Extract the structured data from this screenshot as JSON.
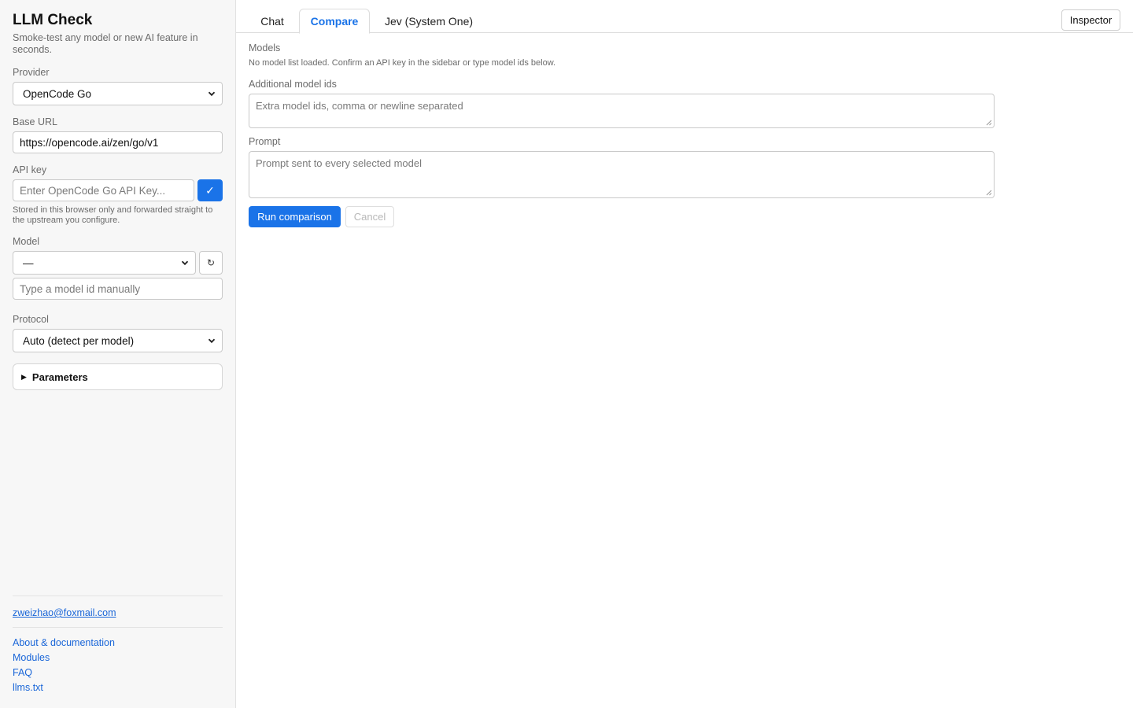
{
  "sidebar": {
    "title": "LLM Check",
    "subtitle": "Smoke-test any model or new AI feature in seconds.",
    "provider": {
      "label": "Provider",
      "value": "OpenCode Go"
    },
    "base_url": {
      "label": "Base URL",
      "value": "https://opencode.ai/zen/go/v1"
    },
    "api_key": {
      "label": "API key",
      "placeholder": "Enter OpenCode Go API Key...",
      "confirm_glyph": "✓",
      "helper": "Stored in this browser only and forwarded straight to the upstream you configure."
    },
    "model": {
      "label": "Model",
      "value": "—",
      "refresh_glyph": "↻",
      "manual_placeholder": "Type a model id manually"
    },
    "protocol": {
      "label": "Protocol",
      "value": "Auto (detect per model)"
    },
    "parameters": {
      "label": "Parameters",
      "glyph": "▶"
    },
    "email": "zweizhao@foxmail.com",
    "links": [
      "About & documentation",
      "Modules",
      "FAQ",
      "llms.txt"
    ]
  },
  "main": {
    "tabs": [
      {
        "label": "Chat",
        "active": false
      },
      {
        "label": "Compare",
        "active": true
      },
      {
        "label": "Jev (System One)",
        "active": false
      }
    ],
    "inspector_label": "Inspector",
    "models": {
      "label": "Models",
      "note": "No model list loaded. Confirm an API key in the sidebar or type model ids below."
    },
    "additional": {
      "label": "Additional model ids",
      "placeholder": "Extra model ids, comma or newline separated"
    },
    "prompt": {
      "label": "Prompt",
      "placeholder": "Prompt sent to every selected model"
    },
    "run_label": "Run comparison",
    "cancel_label": "Cancel"
  },
  "colors": {
    "accent": "#1a73e8",
    "link": "#1a66d8",
    "sidebar_bg": "#f7f7f7"
  }
}
